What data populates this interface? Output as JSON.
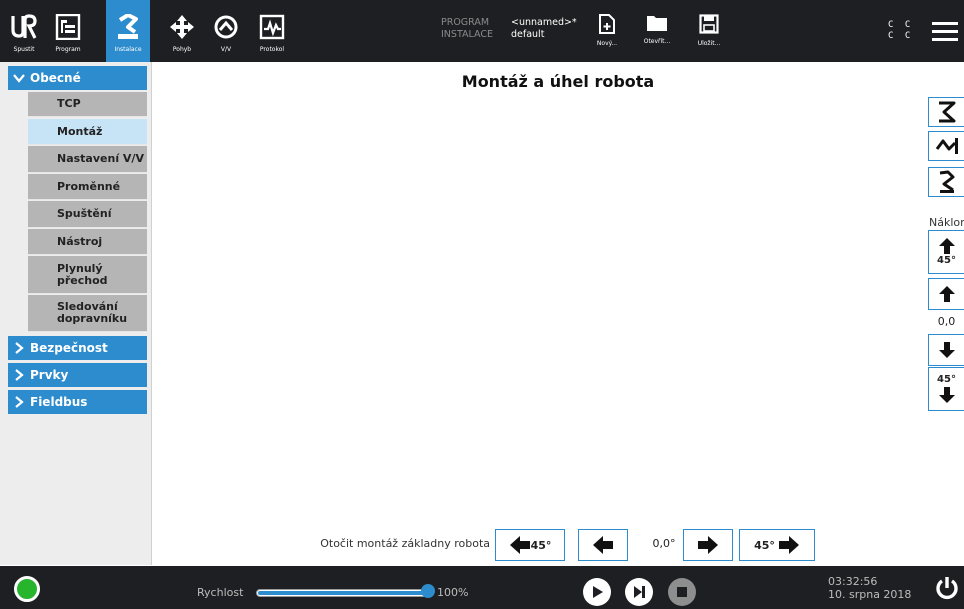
{
  "topbar": {
    "tabs": [
      {
        "label": "Spustit",
        "icon": "ur-logo-icon"
      },
      {
        "label": "Program",
        "icon": "program-icon"
      },
      {
        "label": "Instalace",
        "icon": "installation-icon",
        "active": true
      },
      {
        "label": "Pohyb",
        "icon": "move-icon"
      },
      {
        "label": "V/V",
        "icon": "io-icon"
      },
      {
        "label": "Protokol",
        "icon": "log-icon"
      }
    ],
    "program_key": "PROGRAM",
    "program_value": "<unnamed>*",
    "installation_key": "INSTALACE",
    "installation_value": "default",
    "file_buttons": [
      {
        "label": "Nový...",
        "icon": "new-file-icon"
      },
      {
        "label": "Otevřít...",
        "icon": "folder-icon"
      },
      {
        "label": "Uložit...",
        "icon": "save-icon"
      }
    ],
    "cc_top": "C C",
    "cc_bottom": "C C",
    "menu_icon": "hamburger-icon"
  },
  "sidebar": {
    "categories": [
      {
        "label": "Obecné",
        "expanded": true
      },
      {
        "label": "Bezpečnost",
        "expanded": false
      },
      {
        "label": "Prvky",
        "expanded": false
      },
      {
        "label": "Fieldbus",
        "expanded": false
      }
    ],
    "items": [
      {
        "label": "TCP"
      },
      {
        "label": "Montáž",
        "selected": true
      },
      {
        "label": "Nastavení V/V"
      },
      {
        "label": "Proměnné"
      },
      {
        "label": "Spuštění"
      },
      {
        "label": "Nástroj"
      },
      {
        "label": "Plynulý přechod"
      },
      {
        "label": "Sledování dopravníku"
      }
    ]
  },
  "main": {
    "title": "Montáž a úhel robota",
    "tilt_label": "Náklon",
    "tilt_up_step": "45°",
    "tilt_value": "0,0",
    "tilt_down_step": "45°",
    "rotate_label": "Otočit montáž základny robota",
    "rotate_left_step": "45°",
    "rotate_value": "0,0°",
    "rotate_right_step": "45°"
  },
  "footer": {
    "speed_label": "Rychlost",
    "speed_value": "100%",
    "speed_fraction": 1.0,
    "time": "03:32:56",
    "date": "10. srpna 2018",
    "status_color": "#27b52e",
    "accent": "#2c8ccd"
  }
}
